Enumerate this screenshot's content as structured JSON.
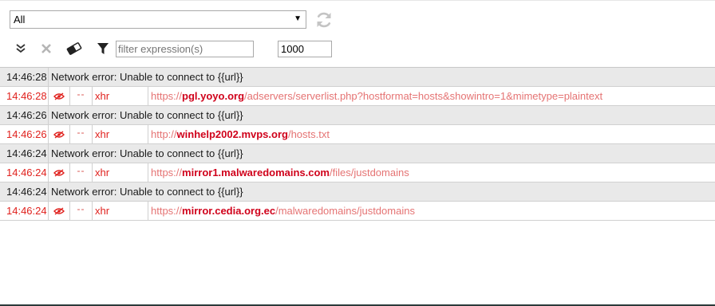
{
  "toolbar": {
    "select_value": "All",
    "reload_icon": "reload-icon",
    "filter_placeholder": "filter expression(s)",
    "max_entries": "1000",
    "icons": [
      "expand-all-icon",
      "clear-icon",
      "eraser-icon",
      "filter-icon"
    ]
  },
  "colors": {
    "error_row_bg": "#e9e9e9",
    "request_red": "#e0211d",
    "url_light_red": "#e57373",
    "host_red": "#d0021b"
  },
  "log": [
    {
      "kind": "error",
      "time": "14:46:28",
      "message": "Network error: Unable to connect to {{url}}"
    },
    {
      "kind": "request",
      "time": "14:46:28",
      "icon": "eye-blocked-icon",
      "dash": "--",
      "type": "xhr",
      "url_pre": "https://",
      "url_host": "pgl.yoyo.org",
      "url_post": "/adservers/serverlist.php?hostformat=hosts&showintro=1&mimetype=plaintext"
    },
    {
      "kind": "error",
      "time": "14:46:26",
      "message": "Network error: Unable to connect to {{url}}"
    },
    {
      "kind": "request",
      "time": "14:46:26",
      "icon": "eye-blocked-icon",
      "dash": "--",
      "type": "xhr",
      "url_pre": "http://",
      "url_host": "winhelp2002.mvps.org",
      "url_post": "/hosts.txt"
    },
    {
      "kind": "error",
      "time": "14:46:24",
      "message": "Network error: Unable to connect to {{url}}"
    },
    {
      "kind": "request",
      "time": "14:46:24",
      "icon": "eye-blocked-icon",
      "dash": "--",
      "type": "xhr",
      "url_pre": "https://",
      "url_host": "mirror1.malwaredomains.com",
      "url_post": "/files/justdomains"
    },
    {
      "kind": "error",
      "time": "14:46:24",
      "message": "Network error: Unable to connect to {{url}}"
    },
    {
      "kind": "request",
      "time": "14:46:24",
      "icon": "eye-blocked-icon",
      "dash": "--",
      "type": "xhr",
      "url_pre": "https://",
      "url_host": "mirror.cedia.org.ec",
      "url_post": "/malwaredomains/justdomains"
    }
  ]
}
